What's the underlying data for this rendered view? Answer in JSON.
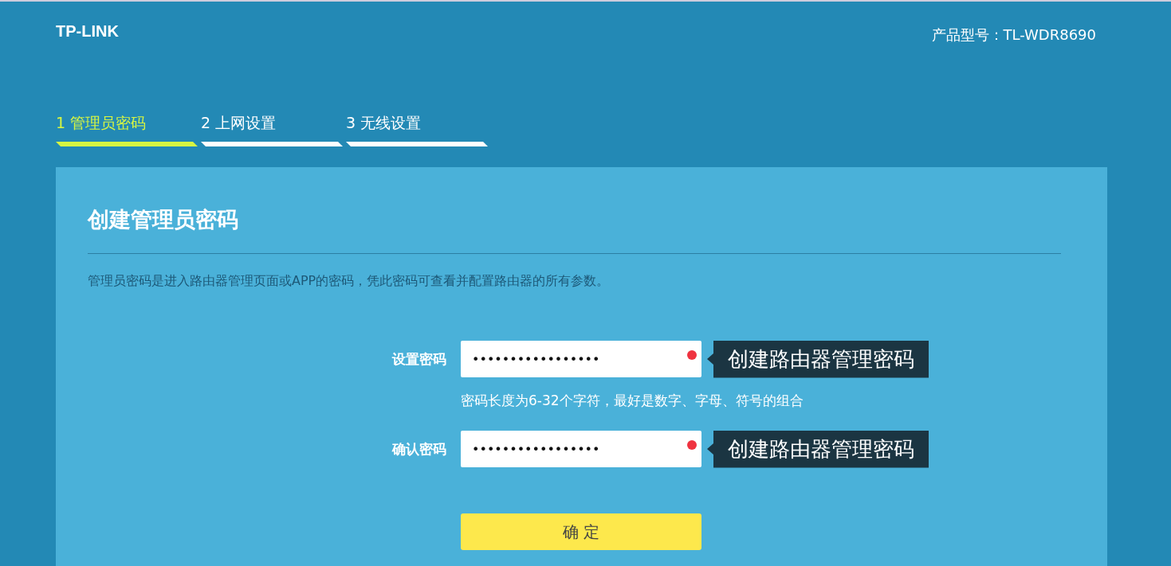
{
  "header": {
    "logo": "TP-LINK",
    "model": "产品型号：TL-WDR8690"
  },
  "steps": [
    {
      "label": "1 管理员密码",
      "selected": true
    },
    {
      "label": "2 上网设置",
      "selected": false
    },
    {
      "label": "3 无线设置",
      "selected": false
    }
  ],
  "card": {
    "title": "创建管理员密码",
    "description": "管理员密码是进入路由器管理页面或APP的密码，凭此密码可查看并配置路由器的所有参数。",
    "fields": [
      {
        "label": "设置密码",
        "value": "•••••••••••••••••",
        "required": true,
        "tooltip": "创建路由器管理密码",
        "hint": "密码长度为6-32个字符，最好是数字、字母、符号的组合"
      },
      {
        "label": "确认密码",
        "value": "•••••••••••••••••",
        "required": true,
        "tooltip": "创建路由器管理密码"
      }
    ],
    "submit": "确 定"
  }
}
